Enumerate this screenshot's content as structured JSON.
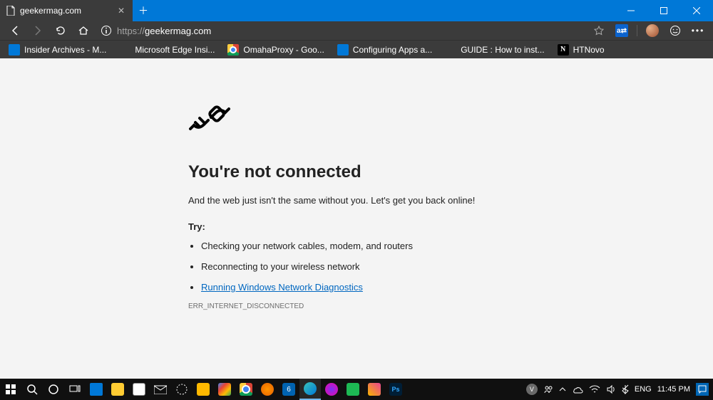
{
  "tab": {
    "title": "geekermag.com"
  },
  "url": {
    "scheme": "https://",
    "host": "geekermag.com"
  },
  "bookmarks": [
    {
      "label": "Insider Archives - M..."
    },
    {
      "label": "Microsoft Edge Insi..."
    },
    {
      "label": "OmahaProxy - Goo..."
    },
    {
      "label": "Configuring Apps a..."
    },
    {
      "label": "GUIDE : How to inst..."
    },
    {
      "label": "HTNovo"
    }
  ],
  "error": {
    "heading": "You're not connected",
    "sub": "And the web just isn't the same without you. Let's get you back online!",
    "try_label": "Try:",
    "items": [
      "Checking your network cables, modem, and routers",
      "Reconnecting to your wireless network"
    ],
    "link": "Running Windows Network Diagnostics",
    "code": "ERR_INTERNET_DISCONNECTED"
  },
  "tray": {
    "lang": "ENG",
    "time": "11:45 PM"
  }
}
